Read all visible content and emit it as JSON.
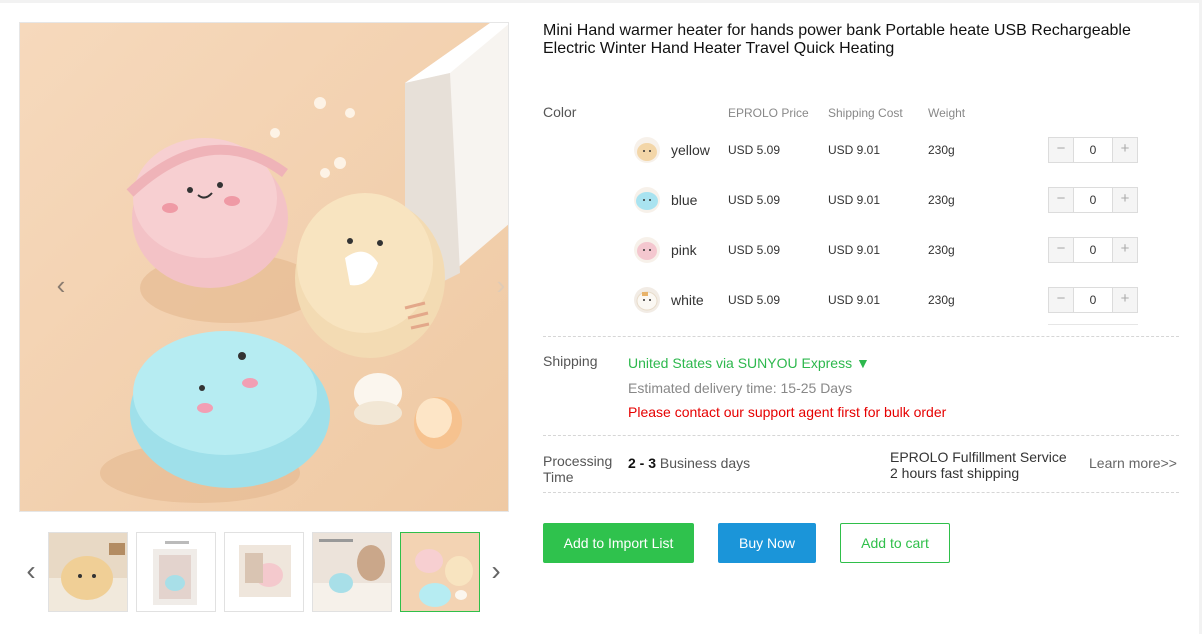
{
  "product": {
    "title": "Mini Hand warmer heater for hands power bank Portable heate USB Rechargeable Electric Winter Hand Heater Travel Quick Heating"
  },
  "gallery": {
    "thumbnail_count": 5,
    "active_thumbnail": 5,
    "prev_arrow": "‹",
    "next_arrow": "›",
    "thumb_prev": "‹",
    "thumb_next": "›"
  },
  "variants": {
    "label": "Color",
    "headers": {
      "price": "EPROLO Price",
      "shipping": "Shipping Cost",
      "weight": "Weight"
    },
    "rows": [
      {
        "name": "yellow",
        "price": "USD 5.09",
        "shipping": "USD 9.01",
        "weight": "230g",
        "qty": "0",
        "swatch_color": "#f3d6a8"
      },
      {
        "name": "blue",
        "price": "USD 5.09",
        "shipping": "USD 9.01",
        "weight": "230g",
        "qty": "0",
        "swatch_color": "#a9e3f0"
      },
      {
        "name": "pink",
        "price": "USD 5.09",
        "shipping": "USD 9.01",
        "weight": "230g",
        "qty": "0",
        "swatch_color": "#f4c7cf"
      },
      {
        "name": "white",
        "price": "USD 5.09",
        "shipping": "USD 9.01",
        "weight": "230g",
        "qty": "0",
        "swatch_color": "#f5efe6"
      }
    ],
    "minus": "−",
    "plus": "+"
  },
  "shipping": {
    "label": "Shipping",
    "method": "United States via SUNYOU Express ▼",
    "estimate": "Estimated delivery time: 15-25 Days",
    "warning": "Please contact our support agent first for bulk order"
  },
  "processing": {
    "label_line1": "Processing",
    "label_line2": "Time",
    "days_bold": "2 - 3",
    "days_text": " Business days",
    "service_line1": "EPROLO Fulfillment Service",
    "service_line2": "2 hours fast shipping",
    "learn_more": "Learn more>>"
  },
  "actions": {
    "import": "Add to Import List",
    "buy": "Buy Now",
    "cart": "Add to cart"
  },
  "colors": {
    "green": "#2fc24d",
    "blue": "#1b95d9",
    "warning": "#e60000",
    "shipping_method": "#2db84d"
  }
}
